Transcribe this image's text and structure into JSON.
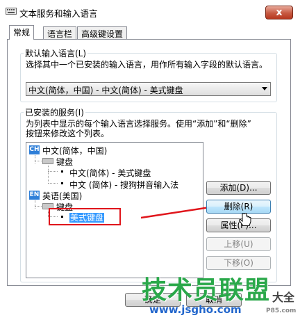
{
  "window": {
    "title": "文本服务和输入语言",
    "close_label": "x"
  },
  "tabs": [
    {
      "label": "常规",
      "active": true
    },
    {
      "label": "语言栏",
      "active": false
    },
    {
      "label": "高级键设置",
      "active": false
    }
  ],
  "default_language": {
    "group_label": "默认输入语言(L)",
    "description": "选择其中一个已安装的输入语言，用作所有输入字段的默认语言。",
    "selected": "中文(简体，中国) - 中文(简体) - 美式键盘"
  },
  "installed_services": {
    "group_label": "已安装的服务(I)",
    "description_line1": "为列表中显示的每个输入语言选择服务。使用“添加”和“删除”",
    "description_line2": "按钮来修改这个列表。",
    "tree": {
      "lang1_badge": "CH",
      "lang1": "中文(简体，中国)",
      "lang1_keyboard": "键盘",
      "lang1_item1": "中文(简体) - 美式键盘",
      "lang1_item2": "中文 (简体) - 搜狗拼音输入法",
      "lang2_badge": "EN",
      "lang2": "英语(美国)",
      "lang2_keyboard": "键盘",
      "lang2_item1": "美式键盘"
    },
    "buttons": {
      "add": "添加(D)...",
      "remove": "删除(R)",
      "properties": "属性(P)...",
      "move_up": "上移(U)",
      "move_down": "下移(O)"
    }
  },
  "footer": {
    "ok_partial": "确定",
    "cancel_partial": "取消"
  },
  "watermark": {
    "brand": "技术员联盟",
    "url": "www.jsgho.com",
    "suffix": "大全",
    "small": "P85.com"
  },
  "colors": {
    "annotation_red": "#e0151b",
    "selection_blue": "#3399ff",
    "watermark_green": "#2aa84a",
    "watermark_blue": "#2266cc"
  }
}
